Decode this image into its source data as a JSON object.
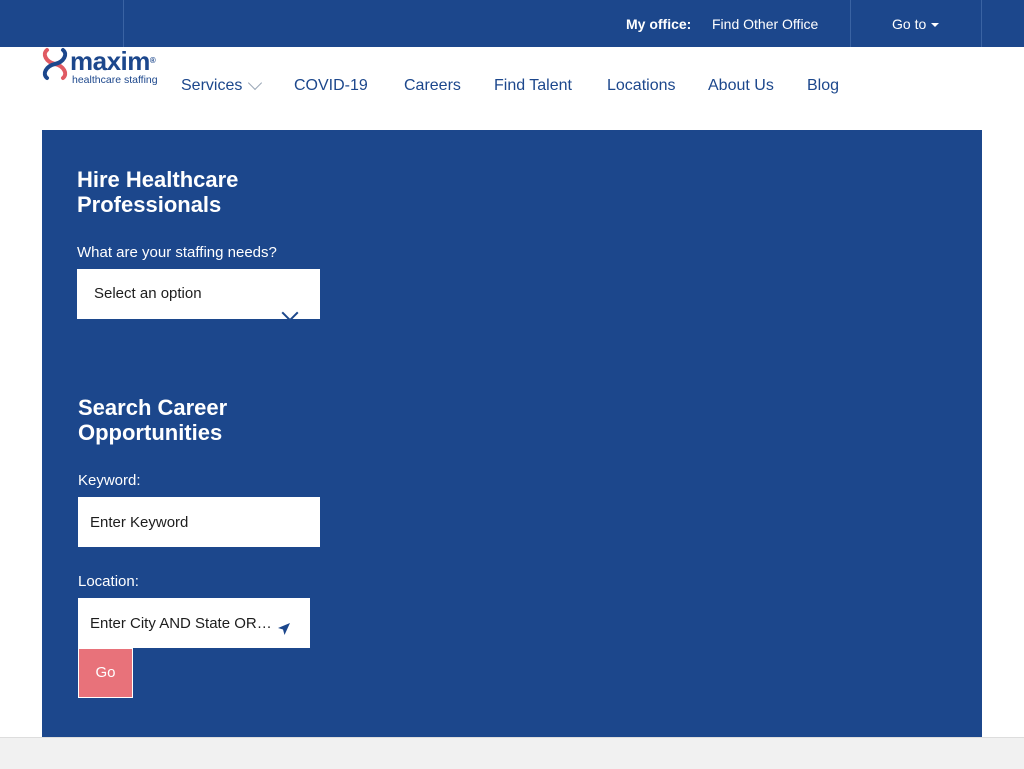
{
  "topbar": {
    "office_label": "My office:",
    "office_link": "Find Other Office",
    "goto_label": "Go to"
  },
  "logo": {
    "brand": "maxim",
    "tagline": "healthcare staffing",
    "trademark": "®"
  },
  "nav": {
    "items": [
      {
        "label": "Services",
        "has_dropdown": true
      },
      {
        "label": "COVID-19"
      },
      {
        "label": "Careers"
      },
      {
        "label": "Find Talent"
      },
      {
        "label": "Locations"
      },
      {
        "label": "About Us"
      },
      {
        "label": "Blog"
      }
    ]
  },
  "hire": {
    "heading_line1": "Hire Healthcare",
    "heading_line2": "Professionals",
    "question": "What are your staffing needs?",
    "select_value": "Select an option"
  },
  "search": {
    "heading_line1": "Search Career",
    "heading_line2": "Opportunities",
    "keyword_label": "Keyword:",
    "keyword_placeholder": "Enter Keyword",
    "location_label": "Location:",
    "location_placeholder": "Enter City AND State OR Zip",
    "go_label": "Go"
  },
  "colors": {
    "brand_blue": "#1c478c",
    "logo_red": "#e05a63",
    "go_button": "#e8727a",
    "footer_gray": "#f1f1f1"
  },
  "icons": {
    "logo_mark": "x-heart-logo-icon",
    "services_chevron": "chevron-down-icon",
    "select_chevron": "chevron-down-icon",
    "location": "location-arrow-icon",
    "goto_caret": "caret-down-icon"
  }
}
